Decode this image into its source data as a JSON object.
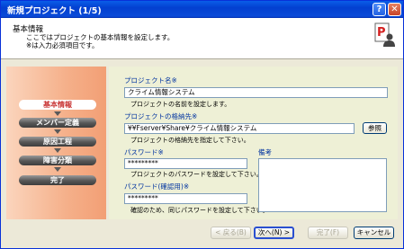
{
  "window": {
    "title": "新規プロジェクト (1/5)",
    "help_label": "?",
    "close_label": "✕"
  },
  "header": {
    "title": "基本情報",
    "desc_line1": "ここではプロジェクトの基本情報を設定します。",
    "desc_line2": "※は入力必須項目です。",
    "logo_icon": "project-person-icon"
  },
  "steps": [
    {
      "label": "基本情報",
      "active": true
    },
    {
      "label": "メンバー定義",
      "active": false
    },
    {
      "label": "原因工程",
      "active": false
    },
    {
      "label": "障害分類",
      "active": false
    },
    {
      "label": "完了",
      "active": false
    }
  ],
  "form": {
    "project_name": {
      "label": "プロジェクト名※",
      "value": "クライム情報システム",
      "hint": "プロジェクトの名前を設定します。"
    },
    "storage": {
      "label": "プロジェクトの格納先※",
      "value": "¥¥Fserver¥Share¥クライム情報システム",
      "hint": "プロジェクトの格納先を指定して下さい。",
      "browse_label": "参照"
    },
    "password": {
      "label": "パスワード※",
      "value": "*********",
      "hint": "プロジェクトのパスワードを設定して下さい。"
    },
    "password_confirm": {
      "label": "パスワード(確認用)※",
      "value": "*********",
      "hint": "確認のため、同じパスワードを設定して下さい。"
    },
    "notes": {
      "label": "備考",
      "value": ""
    }
  },
  "buttons": {
    "back": "< 戻る(B)",
    "next": "次へ(N) >",
    "finish": "完了(F)",
    "cancel": "キャンセル"
  },
  "colors": {
    "titlebar": "#0a4bd8",
    "left_panel": "#f5b08a",
    "form_panel": "#eef0d6",
    "active_step_text": "#c83232"
  }
}
